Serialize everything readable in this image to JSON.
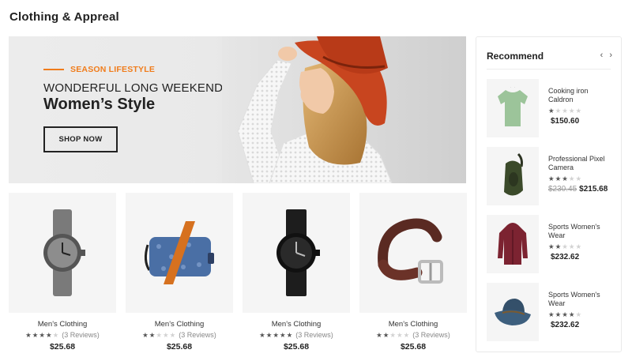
{
  "section": {
    "title": "Clothing & Appreal"
  },
  "hero": {
    "tag": "SEASON LIFESTYLE",
    "subtitle": "WONDERFUL LONG WEEKEND",
    "title": "Women’s Style",
    "button_label": "SHOP NOW"
  },
  "products": [
    {
      "name": "Men's Clothing",
      "rating": 4,
      "reviews": "(3 Reviews)",
      "price": "$25.68",
      "image": "grey-watch"
    },
    {
      "name": "Men's Clothing",
      "rating": 2,
      "reviews": "(3 Reviews)",
      "price": "$25.68",
      "image": "denim-bag"
    },
    {
      "name": "Men's Clothing",
      "rating": 5,
      "reviews": "(3 Reviews)",
      "price": "$25.68",
      "image": "black-watch"
    },
    {
      "name": "Men's Clothing",
      "rating": 2,
      "reviews": "(3 Reviews)",
      "price": "$25.68",
      "image": "leather-belt"
    }
  ],
  "recommend": {
    "title": "Recommend",
    "prev_icon": "chevron-left-icon",
    "next_icon": "chevron-right-icon",
    "items": [
      {
        "name": "Cooking iron Caldron",
        "rating": 1,
        "old_price": "",
        "price": "$150.60",
        "image": "green-tshirt"
      },
      {
        "name": "Professional Pixel Camera",
        "rating": 3,
        "old_price": "$230.45",
        "price": "$215.68",
        "image": "sling-bag"
      },
      {
        "name": "Sports Women's Wear",
        "rating": 2,
        "old_price": "",
        "price": "$232.62",
        "image": "red-coat"
      },
      {
        "name": "Sports Women's Wear",
        "rating": 4,
        "old_price": "",
        "price": "$232.62",
        "image": "bucket-hat"
      }
    ]
  },
  "colors": {
    "accent": "#f07c1b",
    "text": "#222222",
    "card_bg": "#f5f5f5"
  }
}
